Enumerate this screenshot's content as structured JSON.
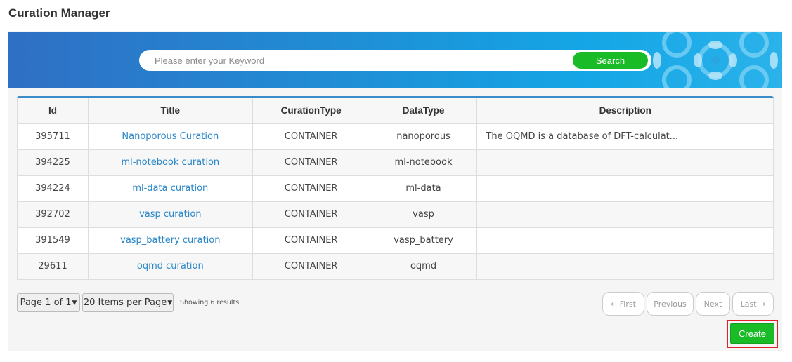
{
  "page": {
    "title": "Curation Manager"
  },
  "search": {
    "placeholder": "Please enter your Keyword",
    "button_label": "Search"
  },
  "table": {
    "columns": [
      "Id",
      "Title",
      "CurationType",
      "DataType",
      "Description"
    ],
    "rows": [
      {
        "id": "395711",
        "title": "Nanoporous Curation",
        "type": "CONTAINER",
        "data_type": "nanoporous",
        "description": "The OQMD is a database of DFT-calculat..."
      },
      {
        "id": "394225",
        "title": "ml-notebook curation",
        "type": "CONTAINER",
        "data_type": "ml-notebook",
        "description": ""
      },
      {
        "id": "394224",
        "title": "ml-data curation",
        "type": "CONTAINER",
        "data_type": "ml-data",
        "description": ""
      },
      {
        "id": "392702",
        "title": "vasp curation",
        "type": "CONTAINER",
        "data_type": "vasp",
        "description": ""
      },
      {
        "id": "391549",
        "title": "vasp_battery curation",
        "type": "CONTAINER",
        "data_type": "vasp_battery",
        "description": ""
      },
      {
        "id": "29611",
        "title": "oqmd curation",
        "type": "CONTAINER",
        "data_type": "oqmd",
        "description": ""
      }
    ]
  },
  "pagination": {
    "page_label": "Page 1 of 1",
    "per_page_label": "20 Items per Page",
    "showing": "Showing 6 results.",
    "first": "← First",
    "previous": "Previous",
    "next": "Next",
    "last": "Last →"
  },
  "actions": {
    "create_label": "Create"
  },
  "colors": {
    "accent_green": "#19bb26",
    "link_blue": "#2a86c8",
    "highlight_red": "#e0202a"
  }
}
